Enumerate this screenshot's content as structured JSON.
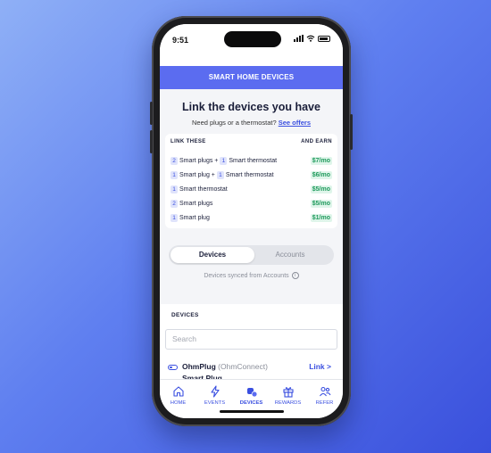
{
  "status": {
    "time": "9:51"
  },
  "header": {
    "title": "SMART HOME DEVICES"
  },
  "main": {
    "headline": "Link the devices you have",
    "subline_text": "Need plugs or a thermostat?",
    "subline_link": "See offers"
  },
  "earn_card": {
    "col_left": "LINK THESE",
    "col_right": "AND EARN",
    "rows": [
      {
        "n1": "2",
        "t1": "Smart plugs +",
        "n2": "1",
        "t2": "Smart thermostat",
        "price": "$7/mo"
      },
      {
        "n1": "1",
        "t1": "Smart plug +",
        "n2": "1",
        "t2": "Smart thermostat",
        "price": "$6/mo"
      },
      {
        "n1": "1",
        "t1": "Smart thermostat",
        "price": "$5/mo"
      },
      {
        "n1": "2",
        "t1": "Smart plugs",
        "price": "$5/mo"
      },
      {
        "n1": "1",
        "t1": "Smart plug",
        "price": "$1/mo"
      }
    ]
  },
  "segmented": {
    "active": "Devices",
    "inactive": "Accounts"
  },
  "synced_text": "Devices synced from Accounts",
  "devices": {
    "label": "DEVICES",
    "search_placeholder": "Search",
    "items": [
      {
        "name": "OhmPlug",
        "source": "(OhmConnect)",
        "type": "Smart Plug",
        "action": "Link >"
      }
    ]
  },
  "tabs": [
    {
      "label": "HOME",
      "icon": "home-icon"
    },
    {
      "label": "EVENTS",
      "icon": "bolt-icon"
    },
    {
      "label": "DEVICES",
      "icon": "devices-icon",
      "active": true
    },
    {
      "label": "REWARDS",
      "icon": "gift-icon"
    },
    {
      "label": "REFER",
      "icon": "users-icon"
    }
  ],
  "colors": {
    "accent": "#5b6cf0",
    "link": "#3a4fe0",
    "earn_green": "#1f9a5c"
  }
}
